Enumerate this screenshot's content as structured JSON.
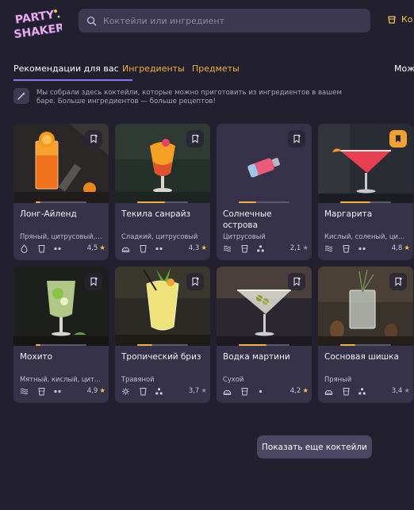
{
  "header": {
    "logo_text": [
      "PARTY",
      "SHAKER"
    ],
    "search_placeholder": "Коктейли или ингредиент",
    "top_right_label": "Ко"
  },
  "tabs": [
    {
      "label": "Рекомендации для вас"
    },
    {
      "label": "Ингредиенты"
    },
    {
      "label": "Предметы"
    },
    {
      "label": "Мож"
    }
  ],
  "info": {
    "text": "Мы собрали здесь коктейли, которые можно приготовить из ингредиентов в вашем баре. Больше ингредиентов — больше рецептов!"
  },
  "colors": {
    "background": "#221f2e",
    "card": "#35324a",
    "accent_orange": "#f3b13d",
    "accent_purple": "#8d7cf0",
    "star_filled": "#f3c14e",
    "star_empty": "#8f8aa3"
  },
  "cocktails": [
    {
      "name": "Лонг-Айленд",
      "tags": "Пряный, цитрусовый, ...",
      "rating": "4,5",
      "star": "filled",
      "bookmarked": false,
      "progress": 0.1
    },
    {
      "name": "Текила санрайз",
      "tags": "Сладкий, цитрусовый",
      "rating": "4,3",
      "star": "filled",
      "bookmarked": false,
      "progress": 0.55
    },
    {
      "name": "Солнечные острова",
      "tags": "Цитрусовый",
      "rating": "2,1",
      "star": "empty",
      "bookmarked": false,
      "progress": 0.35
    },
    {
      "name": "Маргарита",
      "tags": "Кислый, соленый, цит...",
      "rating": "4,8",
      "star": "filled",
      "bookmarked": true,
      "progress": 0.6
    },
    {
      "name": "Мохито",
      "tags": "Мятный, кислый, цит...",
      "rating": "4,9",
      "star": "filled",
      "bookmarked": false,
      "progress": 0.1
    },
    {
      "name": "Тропический бриз",
      "tags": "Травяной",
      "rating": "3,7",
      "star": "empty",
      "bookmarked": false,
      "progress": 0.3
    },
    {
      "name": "Водка мартини",
      "tags": "Сухой",
      "rating": "4,2",
      "star": "filled",
      "bookmarked": false,
      "progress": 0.55
    },
    {
      "name": "Сосновая шишка",
      "tags": "Пряный",
      "rating": "3,4",
      "star": "empty",
      "bookmarked": false,
      "progress": 0.3
    }
  ],
  "show_more_label": "Показать еще коктейли"
}
